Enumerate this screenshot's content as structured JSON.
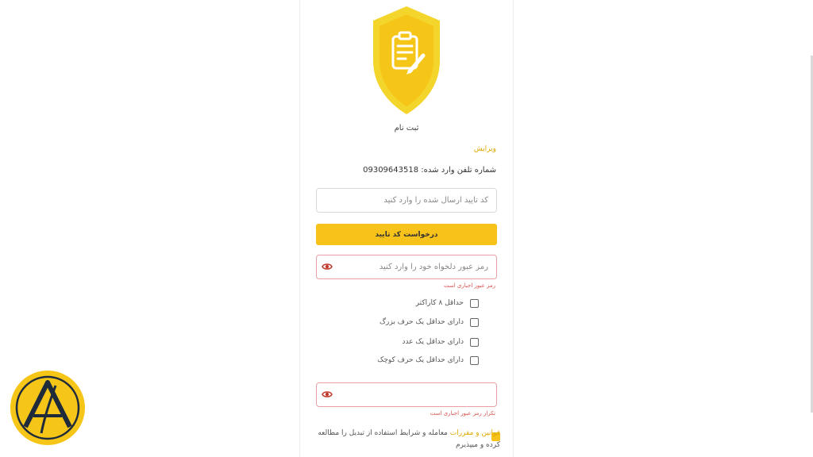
{
  "page": {
    "title": "ثبت نام",
    "edit_link": "ویرایش",
    "phone_label": "شماره تلفن وارد شده:",
    "phone_number": "09309643518"
  },
  "code_field": {
    "placeholder": "کد تایید ارسال شده را وارد کنید"
  },
  "request_button": {
    "label": "درخواست کد تایید"
  },
  "password_field": {
    "placeholder": "رمز عبور دلخواه خود را وارد کنید",
    "error": "رمز عبور اجباری است"
  },
  "password_rules": [
    "حداقل ۸ کاراکتر",
    "دارای حداقل یک حرف بزرگ",
    "دارای حداقل یک عدد",
    "دارای حداقل یک حرف کوچک"
  ],
  "confirm_field": {
    "value": "",
    "error": "تکرار رمز عبور اجباری است"
  },
  "terms": {
    "link": "قوانین و مقررات",
    "text": "معامله و شرایط استفاده از تبدیل را مطالعه کرده و میپذیرم"
  },
  "colors": {
    "accent": "#f7c21a",
    "error": "#d9534f",
    "shield": "#f7d21a"
  },
  "icons": {
    "shield": "shield-clipboard-icon",
    "eye": "eye-icon",
    "logo": "logo-icon"
  }
}
